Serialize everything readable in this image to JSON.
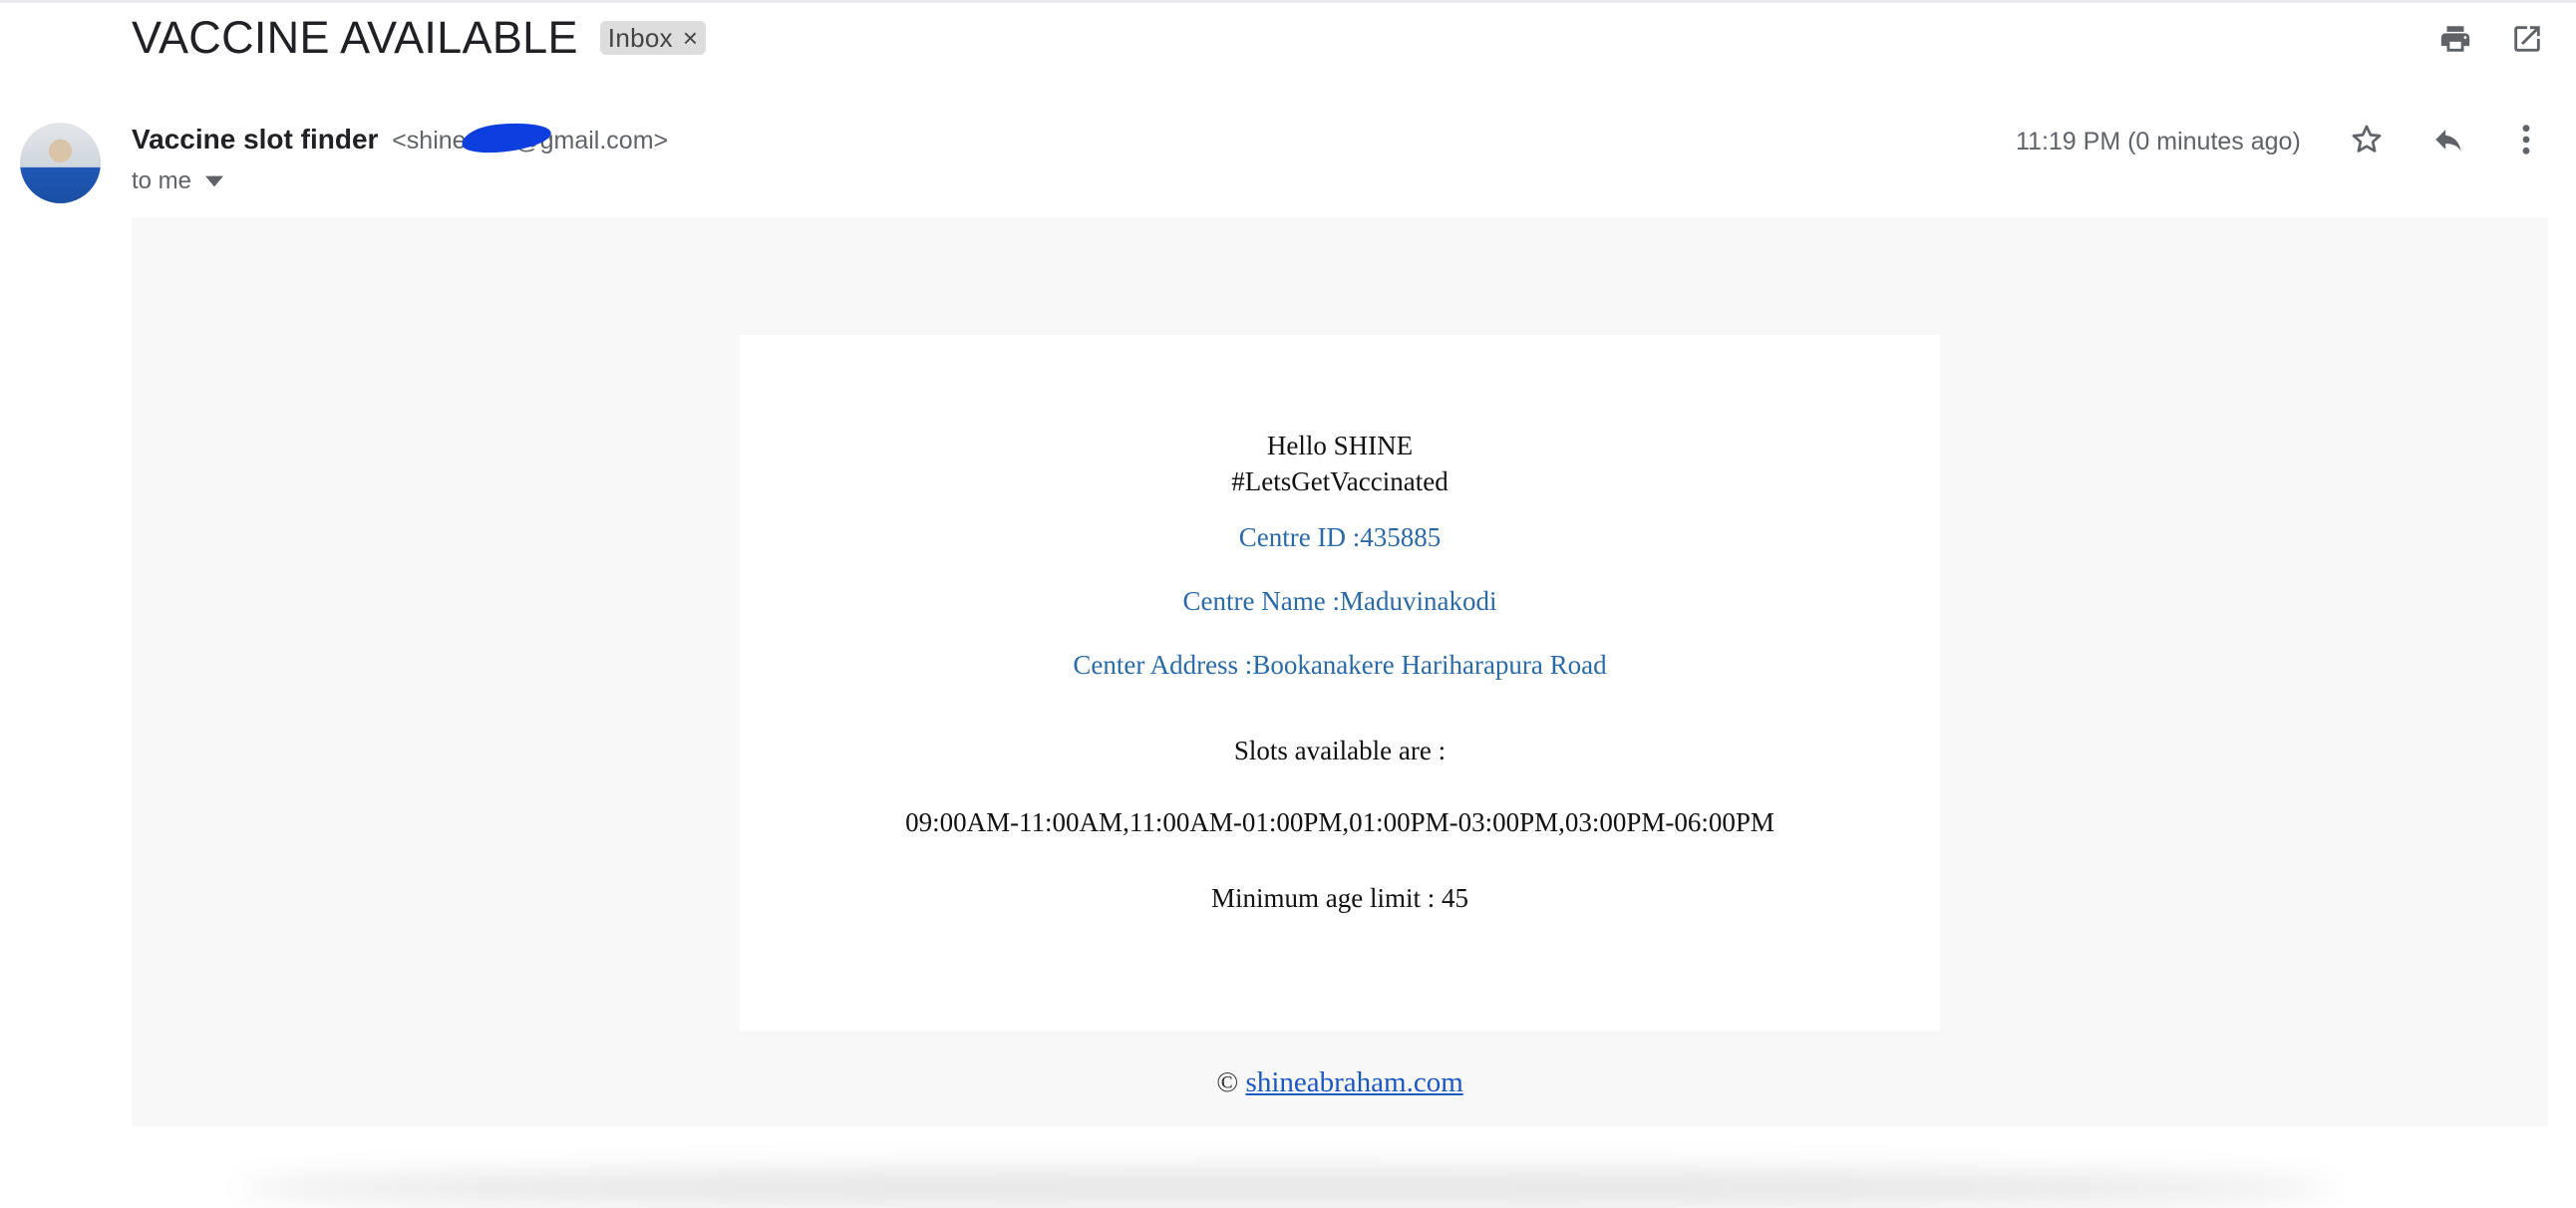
{
  "email": {
    "subject": "VACCINE AVAILABLE",
    "label": "Inbox",
    "label_remove": "×",
    "sender_name": "Vaccine slot finder",
    "sender_email": "<shineab1    @gmail.com>",
    "recipient": "to me",
    "time": "11:19 PM (0 minutes ago)"
  },
  "toolbar": {
    "print_icon": "print-icon",
    "open_new_window_icon": "open-in-new-icon",
    "star_icon": "star-icon",
    "reply_icon": "reply-icon",
    "more_icon": "more-vert-icon"
  },
  "body": {
    "greeting": "Hello SHINE",
    "hashtag": "#LetsGetVaccinated",
    "centre_id": "Centre ID :435885",
    "centre_name": "Centre Name :Maduvinakodi",
    "center_address": "Center Address :Bookanakere Hariharapura Road",
    "slots_heading": "Slots available are :",
    "slots": "09:00AM-11:00AM,11:00AM-01:00PM,01:00PM-03:00PM,03:00PM-06:00PM",
    "min_age": "Minimum age limit : 45",
    "footer_copyright": "©",
    "footer_link": "shineabraham.com"
  },
  "colors": {
    "accent_blue": "#2a6aa8",
    "link": "#1a56c4",
    "frame_bg": "#f8f8f8",
    "redaction": "#0d3fe0"
  }
}
